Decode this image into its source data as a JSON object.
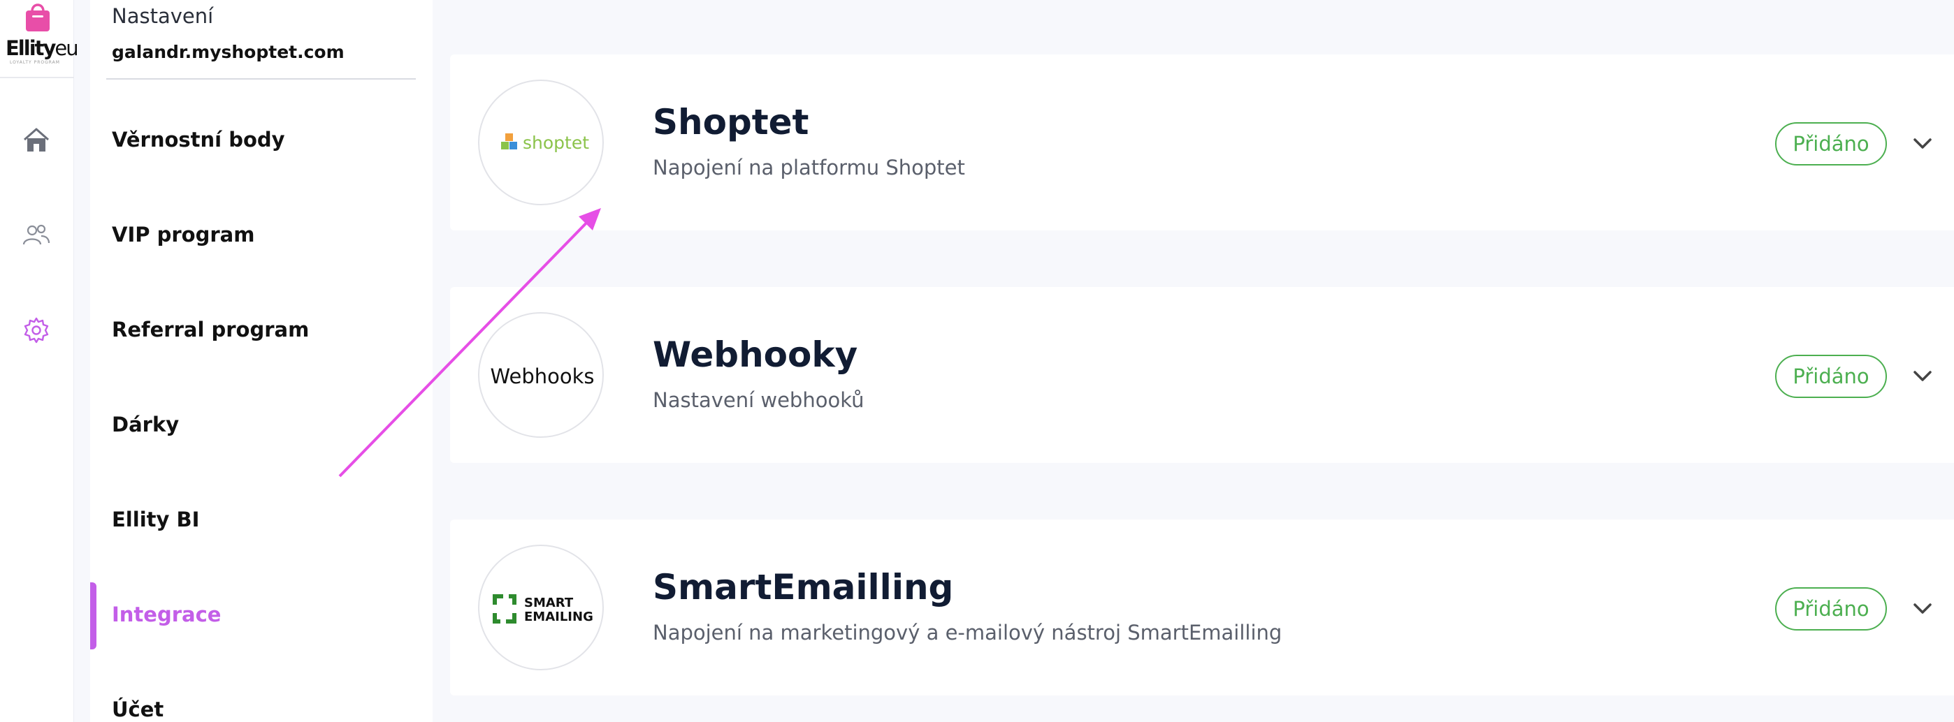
{
  "brand": {
    "logo_text": "Ellity",
    "logo_suffix": "eu",
    "logo_tagline": "LOYALTY PROGRAM"
  },
  "rail": {
    "items": [
      {
        "name": "home",
        "icon": "home-icon"
      },
      {
        "name": "users",
        "icon": "users-icon"
      },
      {
        "name": "settings",
        "icon": "gear-icon",
        "active": true
      }
    ]
  },
  "sidebar": {
    "title": "Nastavení",
    "domain": "galandr.myshoptet.com",
    "items": [
      {
        "label": "Věrnostní body"
      },
      {
        "label": "VIP program"
      },
      {
        "label": "Referral program"
      },
      {
        "label": "Dárky"
      },
      {
        "label": "Ellity BI"
      },
      {
        "label": "Integrace",
        "active": true
      },
      {
        "label": "Účet"
      }
    ]
  },
  "integrations": [
    {
      "title": "Shoptet",
      "description": "Napojení na platformu Shoptet",
      "status": "Přidáno",
      "logo_text": "shoptet"
    },
    {
      "title": "Webhooky",
      "description": "Nastavení webhooků",
      "status": "Přidáno",
      "logo_text": "Webhooks"
    },
    {
      "title": "SmartEmailling",
      "description": "Napojení na marketingový a e-mailový nástroj SmartEmailling",
      "status": "Přidáno",
      "logo_text_1": "SMART",
      "logo_text_2": "EMAILING"
    }
  ],
  "colors": {
    "accent": "#c35ee8",
    "success": "#4caf50",
    "arrow": "#e64ee6",
    "background": "#f7f8fc",
    "title": "#111c33"
  }
}
